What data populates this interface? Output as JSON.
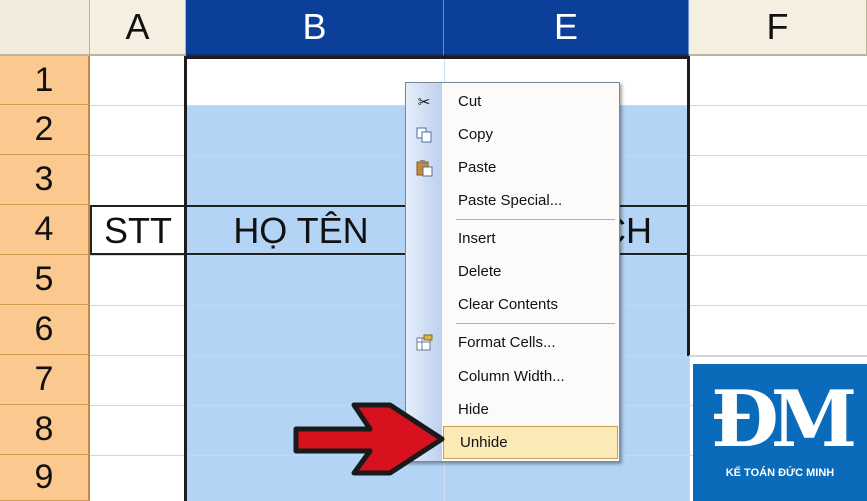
{
  "columns": [
    {
      "label": "A",
      "selected": false
    },
    {
      "label": "B",
      "selected": true
    },
    {
      "label": "E",
      "selected": true
    },
    {
      "label": "F",
      "selected": false
    }
  ],
  "rows": [
    "1",
    "2",
    "3",
    "4",
    "5",
    "6",
    "7",
    "8",
    "9"
  ],
  "cells": {
    "A4": "STT",
    "B4": "HỌ TÊN",
    "E4": "CH"
  },
  "context_menu": {
    "items": [
      {
        "label": "Cut",
        "underline": "t",
        "icon": "scissors-icon"
      },
      {
        "label": "Copy",
        "underline": "C",
        "icon": "copy-icon"
      },
      {
        "label": "Paste",
        "underline": "P",
        "icon": "paste-icon"
      },
      {
        "label": "Paste Special...",
        "underline": "S",
        "icon": ""
      },
      {
        "label": "Insert",
        "underline": "I",
        "icon": ""
      },
      {
        "label": "Delete",
        "underline": "D",
        "icon": ""
      },
      {
        "label": "Clear Contents",
        "underline": "n",
        "icon": ""
      },
      {
        "label": "Format Cells...",
        "underline": "F",
        "icon": "format-cells-icon"
      },
      {
        "label": "Column Width...",
        "underline": "C",
        "icon": ""
      },
      {
        "label": "Hide",
        "underline": "H",
        "icon": ""
      },
      {
        "label": "Unhide",
        "underline": "U",
        "icon": ""
      }
    ],
    "highlighted": "Unhide"
  },
  "logo": {
    "mark": "ĐM",
    "text": "KẾ TOÁN ĐỨC MINH"
  },
  "colors": {
    "selected_header": "#0b3f9a",
    "selected_column": "#b4d4f5",
    "row_header": "#fbc890",
    "arrow": "#d7111e",
    "logo_bg": "#0a6bbb"
  }
}
